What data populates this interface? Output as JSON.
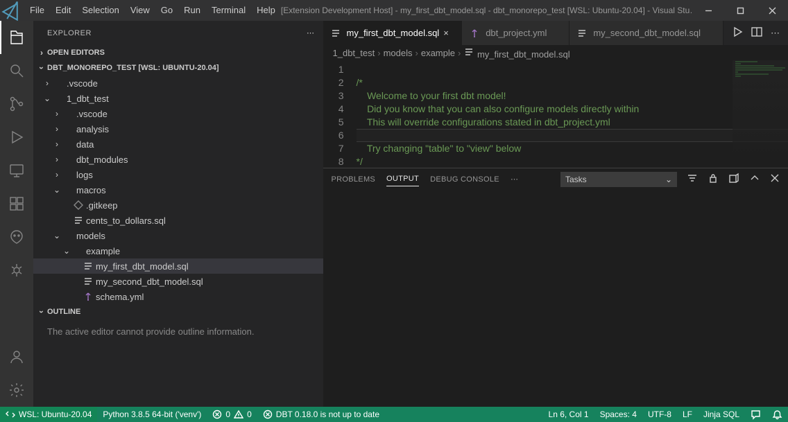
{
  "title": "[Extension Development Host] - my_first_dbt_model.sql - dbt_monorepo_test [WSL: Ubuntu-20.04] - Visual Stu…",
  "menu": [
    "File",
    "Edit",
    "Selection",
    "View",
    "Go",
    "Run",
    "Terminal",
    "Help"
  ],
  "explorer": {
    "title": "EXPLORER",
    "openEditors": "OPEN EDITORS",
    "folder": "DBT_MONOREPO_TEST [WSL: UBUNTU-20.04]",
    "outline": "OUTLINE",
    "outlineMsg": "The active editor cannot provide outline information."
  },
  "tree": [
    {
      "depth": 0,
      "twist": ">",
      "icon": "folder",
      "label": ".vscode"
    },
    {
      "depth": 0,
      "twist": "v",
      "icon": "folder",
      "label": "1_dbt_test"
    },
    {
      "depth": 1,
      "twist": ">",
      "icon": "folder",
      "label": ".vscode"
    },
    {
      "depth": 1,
      "twist": ">",
      "icon": "folder",
      "label": "analysis"
    },
    {
      "depth": 1,
      "twist": ">",
      "icon": "folder",
      "label": "data"
    },
    {
      "depth": 1,
      "twist": ">",
      "icon": "folder",
      "label": "dbt_modules"
    },
    {
      "depth": 1,
      "twist": ">",
      "icon": "folder",
      "label": "logs"
    },
    {
      "depth": 1,
      "twist": "v",
      "icon": "folder",
      "label": "macros"
    },
    {
      "depth": 2,
      "twist": "",
      "icon": "git",
      "label": ".gitkeep"
    },
    {
      "depth": 2,
      "twist": "",
      "icon": "sql",
      "label": "cents_to_dollars.sql"
    },
    {
      "depth": 1,
      "twist": "v",
      "icon": "folder",
      "label": "models"
    },
    {
      "depth": 2,
      "twist": "v",
      "icon": "folder",
      "label": "example"
    },
    {
      "depth": 3,
      "twist": "",
      "icon": "sql",
      "label": "my_first_dbt_model.sql",
      "sel": true
    },
    {
      "depth": 3,
      "twist": "",
      "icon": "sql",
      "label": "my_second_dbt_model.sql"
    },
    {
      "depth": 3,
      "twist": "",
      "icon": "yml",
      "label": "schema.yml"
    }
  ],
  "tabs": [
    {
      "icon": "sql",
      "label": "my_first_dbt_model.sql",
      "active": true,
      "close": true
    },
    {
      "icon": "yml",
      "label": "dbt_project.yml",
      "active": false
    },
    {
      "icon": "sql",
      "label": "my_second_dbt_model.sql",
      "active": false
    }
  ],
  "breadcrumbs": [
    "1_dbt_test",
    "models",
    "example",
    "my_first_dbt_model.sql"
  ],
  "code": {
    "lines": [
      "1",
      "2",
      "3",
      "4",
      "5",
      "6",
      "7",
      "8"
    ],
    "text": [
      "",
      "/*",
      "    Welcome to your first dbt model!",
      "    Did you know that you can also configure models directly within",
      "    This will override configurations stated in dbt_project.yml",
      "",
      "    Try changing \"table\" to \"view\" below",
      "*/"
    ],
    "currentLine": 6
  },
  "panel": {
    "tabs": [
      "PROBLEMS",
      "OUTPUT",
      "DEBUG CONSOLE"
    ],
    "active": "OUTPUT",
    "tasks": "Tasks"
  },
  "status": {
    "remote": "WSL: Ubuntu-20.04",
    "python": "Python 3.8.5 64-bit ('venv')",
    "errors": "0",
    "warnings": "0",
    "dbt": "DBT 0.18.0 is not up to date",
    "lncol": "Ln 6, Col 1",
    "spaces": "Spaces: 4",
    "enc": "UTF-8",
    "eol": "LF",
    "lang": "Jinja SQL"
  }
}
